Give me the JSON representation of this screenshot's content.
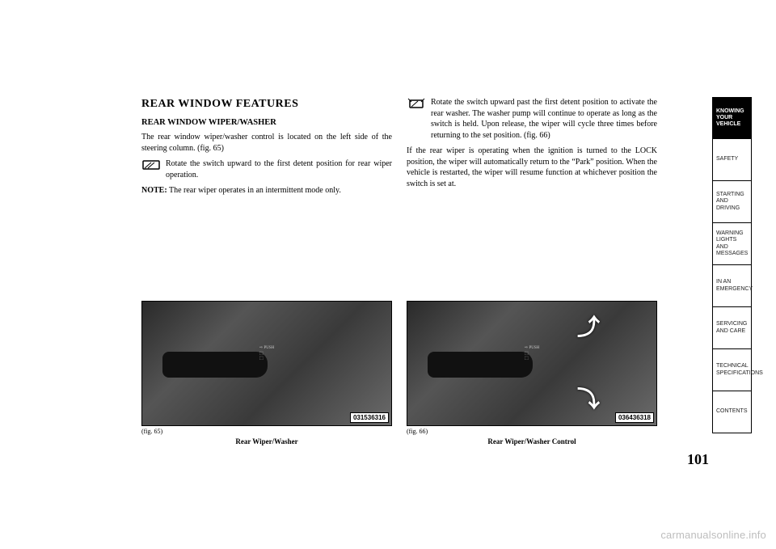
{
  "heading": "REAR WINDOW FEATURES",
  "subheading": "REAR WINDOW WIPER/WASHER",
  "col1": {
    "p1": "The rear window wiper/washer control is located on the left side of the steering column. (fig. 65)",
    "icon_p": "Rotate the switch upward to the first detent position for rear wiper operation.",
    "note_label": "NOTE:",
    "note_text": " The rear wiper operates in an intermittent mode only."
  },
  "col2": {
    "icon_p": "Rotate the switch upward past the first detent position to activate the rear washer. The washer pump will continue to operate as long as the switch is held. Upon release, the wiper will cycle three times before returning to the set position.  (fig. 66)",
    "p2": "If the rear wiper is operating when the ignition is turned to the LOCK position, the wiper will automatically return to the “Park” position. When the vehicle is restarted, the wiper will resume function at whichever position the switch is set at."
  },
  "fig1": {
    "tag": "031536316",
    "num": "(fig. 65)",
    "caption": "Rear Wiper/Washer"
  },
  "fig2": {
    "tag": "036436318",
    "num": "(fig. 66)",
    "caption": "Rear Wiper/Washer Control"
  },
  "pagenum": "101",
  "tabs": [
    "KNOWING YOUR VEHICLE",
    "SAFETY",
    "STARTING AND DRIVING",
    "WARNING LIGHTS AND MESSAGES",
    "IN AN EMERGENCY",
    "SERVICING AND CARE",
    "TECHNICAL SPECIFICATIONS",
    "CONTENTS"
  ],
  "active_tab_index": 0,
  "watermark": "carmanualsonline.info"
}
